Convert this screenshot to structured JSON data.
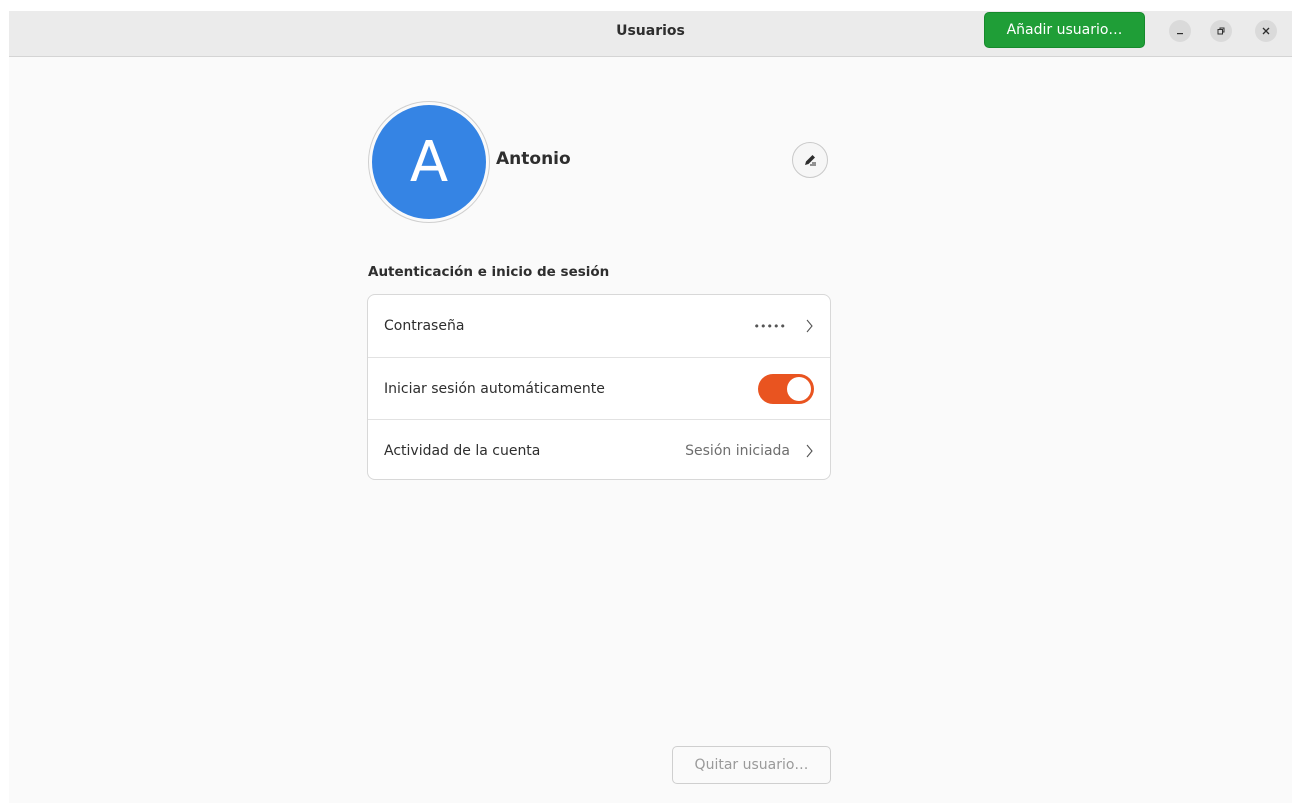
{
  "window": {
    "title": "Usuarios",
    "add_user_label": "Añadir usuario…",
    "controls": [
      "minimize-icon",
      "restore-icon",
      "close-icon"
    ]
  },
  "user": {
    "avatar_letter": "A",
    "name": "Antonio",
    "edit_icon": "edit-pen-icon"
  },
  "auth_section": {
    "title": "Autenticación e inicio de sesión",
    "rows": [
      {
        "label": "Contraseña",
        "value": "•••••"
      },
      {
        "label": "Iniciar sesión automáticamente",
        "toggle_on": true
      },
      {
        "label": "Actividad de la cuenta",
        "value": "Sesión iniciada"
      }
    ]
  },
  "footer": {
    "remove_user_label": "Quitar usuario…"
  },
  "colors": {
    "accent": "#e95420",
    "avatar": "#3584e4",
    "suggested_action": "#1f9e37"
  }
}
